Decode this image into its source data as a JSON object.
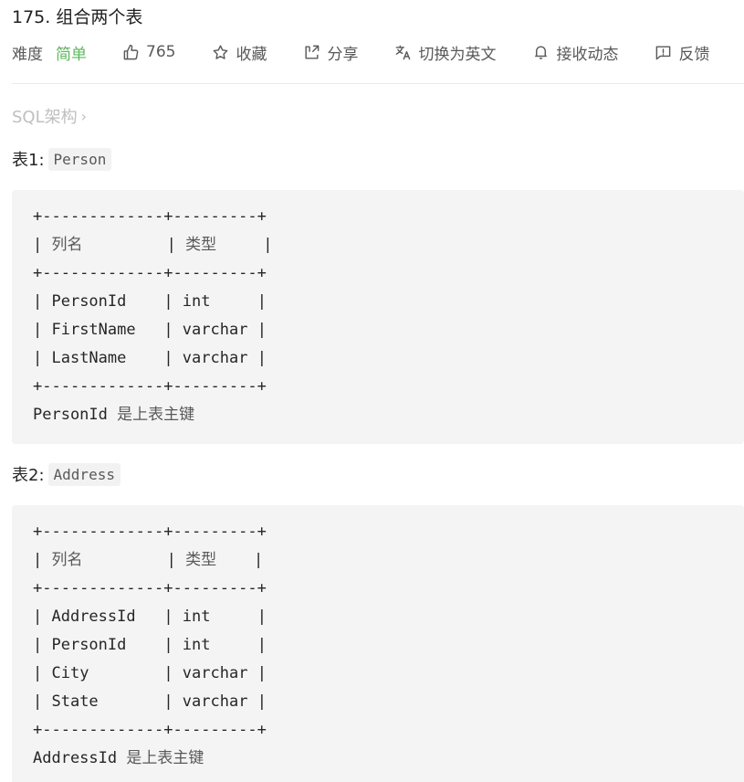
{
  "problem": {
    "title": "175. 组合两个表"
  },
  "meta": {
    "difficulty_label": "难度",
    "difficulty_value": "简单",
    "difficulty_color": "#5cb85c",
    "likes": "765",
    "favorite_label": "收藏",
    "share_label": "分享",
    "translate_label": "切换为英文",
    "notify_label": "接收动态",
    "feedback_label": "反馈"
  },
  "icons": {
    "like": "thumbs-up-icon",
    "favorite": "star-icon",
    "share": "share-icon",
    "translate": "translate-icon",
    "notify": "bell-icon",
    "feedback": "feedback-icon"
  },
  "tag": {
    "label": "SQL架构",
    "chevron": "›"
  },
  "table1": {
    "heading": "表1:",
    "name": "Person",
    "border": "+-------------+---------+",
    "header": {
      "col1": "列名",
      "col2": "类型"
    },
    "rows": [
      {
        "name": "PersonId",
        "type": "int"
      },
      {
        "name": "FirstName",
        "type": "varchar"
      },
      {
        "name": "LastName",
        "type": "varchar"
      }
    ],
    "note_key": "PersonId",
    "note_text": "是上表主键"
  },
  "table2": {
    "heading": "表2:",
    "name": "Address",
    "border": "+-------------+---------+",
    "header": {
      "col1": "列名",
      "col2": "类型"
    },
    "rows": [
      {
        "name": "AddressId",
        "type": "int"
      },
      {
        "name": "PersonId",
        "type": "int"
      },
      {
        "name": "City",
        "type": "varchar"
      },
      {
        "name": "State",
        "type": "varchar"
      }
    ],
    "note_key": "AddressId",
    "note_text": "是上表主键"
  }
}
